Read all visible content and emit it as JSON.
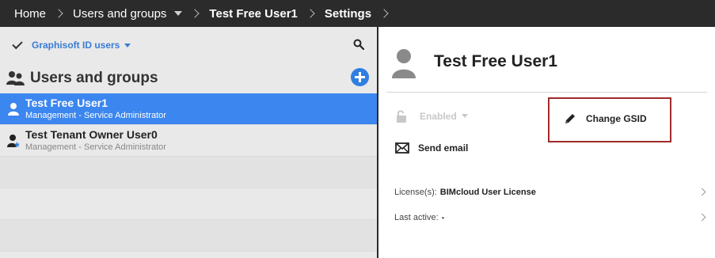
{
  "breadcrumb": {
    "items": [
      "Home",
      "Users and groups",
      "Test Free User1",
      "Settings"
    ]
  },
  "left_panel": {
    "filter_label": "Graphisoft ID users",
    "group_title": "Users and groups",
    "users": [
      {
        "name": "Test Free User1",
        "role": "Management - Service Administrator",
        "selected": true
      },
      {
        "name": "Test Tenant Owner User0",
        "role": "Management - Service Administrator",
        "selected": false
      }
    ]
  },
  "detail": {
    "title": "Test Free User1",
    "enabled_label": "Enabled",
    "change_gsid_label": "Change GSID",
    "send_email_label": "Send email",
    "license_label": "License(s):",
    "license_value": "BIMcloud User License",
    "last_active_label": "Last active:",
    "last_active_value": "-"
  },
  "colors": {
    "topbar": "#2b2b2b",
    "accent": "#3c86ef",
    "highlight_box": "#a12a2a"
  }
}
